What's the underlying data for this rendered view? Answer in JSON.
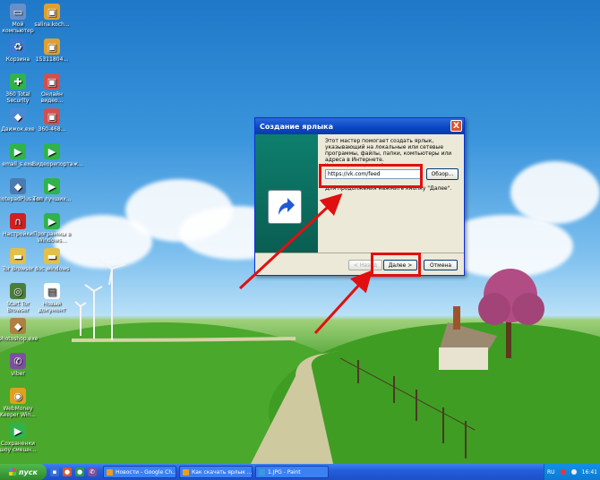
{
  "desktop_icons": [
    {
      "label": "Мой компьютер",
      "icon": "my-computer-icon",
      "color": "#6a8fc8"
    },
    {
      "label": "Корзина",
      "icon": "recycle-bin-icon",
      "color": "#3a7bd5"
    },
    {
      "label": "360 Total Security",
      "icon": "security-icon",
      "color": "#2fb34a"
    },
    {
      "label": "Движок.exe",
      "icon": "app-icon",
      "color": "#4a8ad4"
    },
    {
      "label": "email_s.exe",
      "icon": "video-icon",
      "color": "#2fb34a"
    },
    {
      "label": "notepadPlus.exe",
      "icon": "app-icon",
      "color": "#4a7bb0"
    },
    {
      "label": "Настройки",
      "icon": "magnet-icon",
      "color": "#d02020"
    },
    {
      "label": "Tor Browser",
      "icon": "folder-icon",
      "color": "#e2c04a"
    },
    {
      "label": "Start Tor Browser",
      "icon": "tor-icon",
      "color": "#4a7f3a"
    },
    {
      "label": "photoshop.exe",
      "icon": "app-icon",
      "color": "#b08040"
    },
    {
      "label": "Viber",
      "icon": "viber-icon",
      "color": "#7b519d"
    },
    {
      "label": "WebMoney Keeper Win...",
      "icon": "webmoney-icon",
      "color": "#e0a020"
    },
    {
      "label": "Сохраненки шоу смешн...",
      "icon": "video-icon",
      "color": "#2fb34a"
    },
    {
      "label": "salina.koch...",
      "icon": "image-icon",
      "color": "#e0a030"
    },
    {
      "label": "15311804...",
      "icon": "image-icon",
      "color": "#e0a030"
    },
    {
      "label": "Онлайн видео...",
      "icon": "image-icon",
      "color": "#d05050"
    },
    {
      "label": "360-468...",
      "icon": "image-icon",
      "color": "#d05050"
    },
    {
      "label": "Видеорепортаж...",
      "icon": "video-icon",
      "color": "#2fb34a"
    },
    {
      "label": "Топ лучших...",
      "icon": "video-icon",
      "color": "#2fb34a"
    },
    {
      "label": "Программы в Windows...",
      "icon": "video-icon",
      "color": "#2fb34a"
    },
    {
      "label": "doc windows",
      "icon": "folder-icon",
      "color": "#e2c04a"
    },
    {
      "label": "Новый документ",
      "icon": "document-icon",
      "color": "#ffffff"
    }
  ],
  "dialog": {
    "title": "Создание ярлыка",
    "close": "X",
    "description": "Этот мастер помогает создать ярлык, указывающий на локальные или сетевые программы, файлы, папки, компьютеры или адреса в Интернете.",
    "field_caption": "Укажите размещение объекта:",
    "location_value": "https://vk.com/feed",
    "browse": "Обзор...",
    "hint": "Для продолжения нажмите кнопку \"Далее\".",
    "back": "< Назад",
    "next": "Далее >",
    "cancel": "Отмена"
  },
  "taskbar": {
    "start": "пуск",
    "tasks": [
      {
        "label": "Новости - Google Ch...",
        "icon_color": "#e8a020"
      },
      {
        "label": "Как скачать ярлык ...",
        "icon_color": "#e8a020"
      },
      {
        "label": "1.JPG - Paint",
        "icon_color": "#3a9ad9"
      }
    ],
    "lang": "RU",
    "clock": "16:41"
  },
  "colors": {
    "annotation": "#e01010",
    "taskbar": "#245edb",
    "dialog_title": "#0a46c4"
  }
}
